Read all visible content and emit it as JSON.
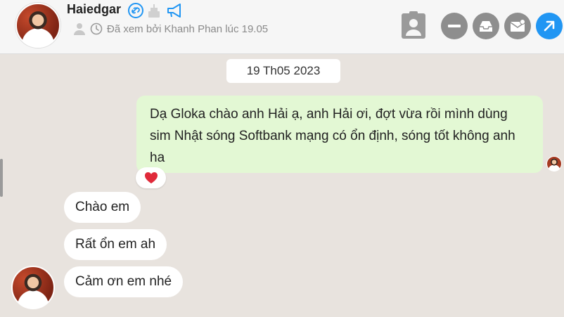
{
  "header": {
    "contact_name": "Haiedgar",
    "seen_status": "Đã xem bởi Khanh Phan lúc 19.05",
    "icons": [
      "verified-link-icon",
      "birthday-cake-icon",
      "megaphone-icon",
      "person-icon",
      "clock-icon"
    ],
    "actions": [
      "contact-card-icon",
      "minus-icon",
      "inbox-icon",
      "email-icon",
      "open-arrow-icon"
    ],
    "accent_color": "#2196f3"
  },
  "conversation": {
    "date": "19 Th05 2023",
    "outgoing": {
      "text": "Dạ Gloka chào anh Hải ạ, anh Hải ơi, đợt vừa rồi mình dùng sim Nhật sóng Softbank mạng có ổn định, sóng tốt không anh ha",
      "reaction": "heart-icon",
      "bubble_color": "#e3f8d4"
    },
    "incoming": [
      {
        "text": "Chào em"
      },
      {
        "text": "Rất ổn em ah"
      },
      {
        "text": "Cảm ơn em nhé"
      }
    ]
  }
}
